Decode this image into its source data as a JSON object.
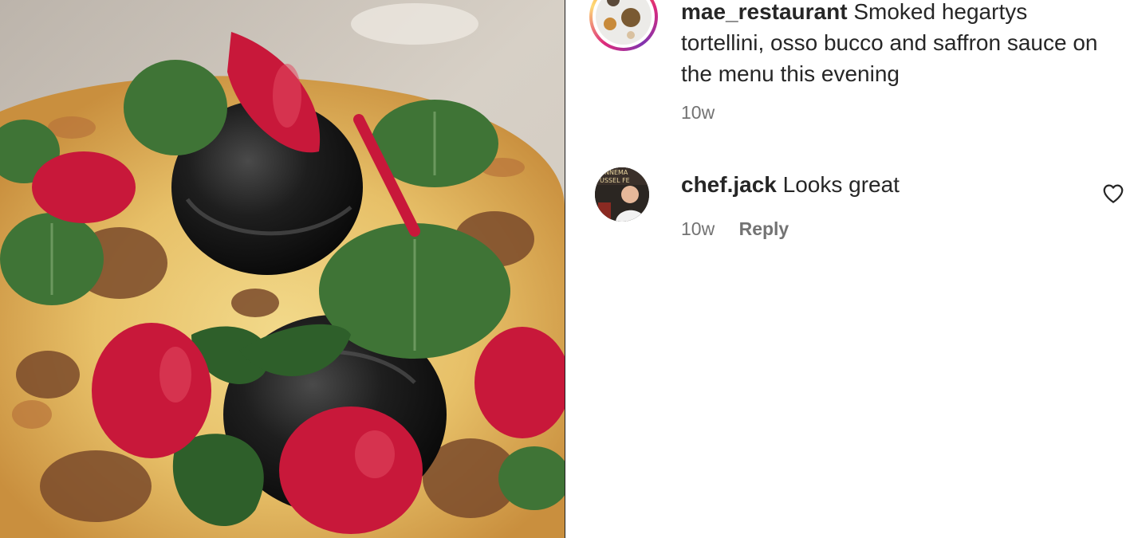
{
  "post": {
    "image_alt": "Plated dish with black tortellini, red beet slices and green leaves",
    "author": {
      "username": "mae_restaurant",
      "caption": "Smoked hegartys tortellini, osso bucco and saffron sauce on the menu this evening",
      "time": "10w"
    }
  },
  "comments": [
    {
      "username": "chef.jack",
      "text": "Looks great",
      "time": "10w",
      "reply_label": "Reply",
      "like_icon": "heart-outline-icon",
      "avatar_text": "NNEMA\nUSSEL FE"
    }
  ],
  "colors": {
    "text": "#262626",
    "muted": "#737373",
    "story_ring": [
      "#f58529",
      "#dd2a7b",
      "#8134af",
      "#feda77"
    ]
  }
}
